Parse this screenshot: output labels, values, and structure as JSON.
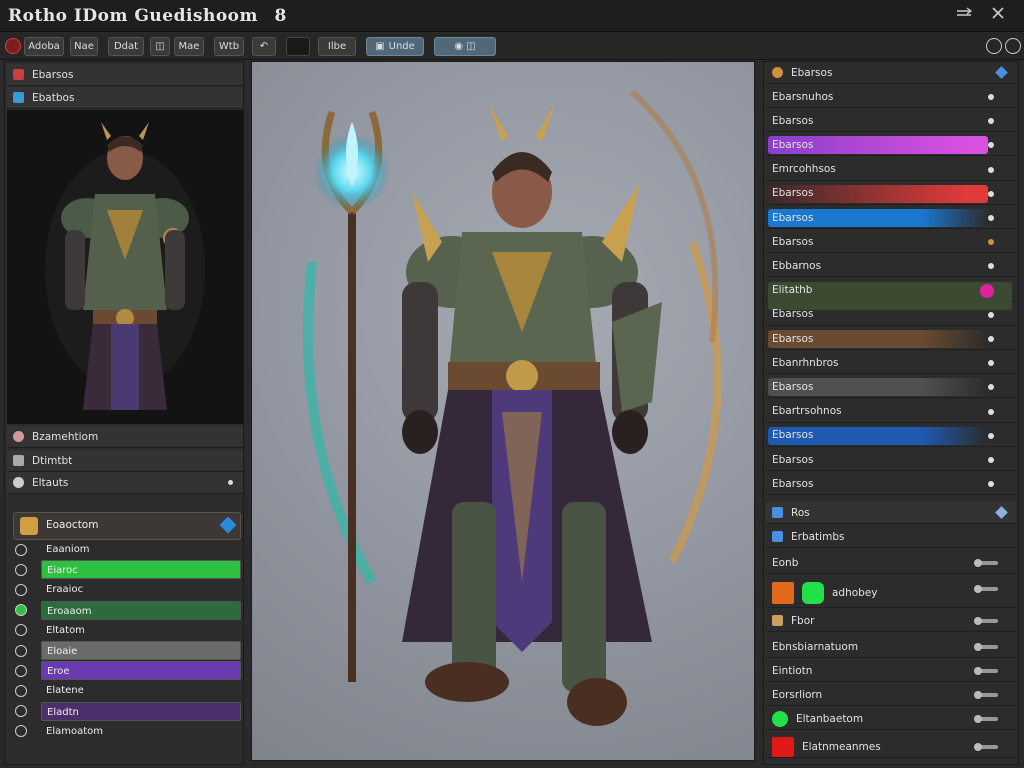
{
  "window": {
    "title": "Rotho IDom Guedishoom",
    "title_suffix": "8"
  },
  "toolbar": {
    "buttons": [
      "Adoba",
      "Nae",
      "Ddat",
      "Mae",
      "Wtb",
      "",
      "Ilbe",
      "Unde",
      "",
      ""
    ]
  },
  "left_panel": {
    "header_1": "Ebarsos",
    "header_2": "Ebatbos",
    "section_rows": [
      "Bzamehtiom",
      "Dtimtbt",
      "Eltauts"
    ],
    "subpanel_label": "Eoaoctom",
    "layers": [
      {
        "label": "Eaaniom",
        "style": "plain",
        "color": ""
      },
      {
        "label": "Eiaroc",
        "style": "bar",
        "color": "#2ec040"
      },
      {
        "label": "Eraaioc",
        "style": "plain",
        "color": ""
      },
      {
        "label": "Eroaaom",
        "style": "bar",
        "color": "#2d6a3c"
      },
      {
        "label": "Eltatom",
        "style": "plain",
        "color": ""
      },
      {
        "label": "Eloaie",
        "style": "bar",
        "color": "#6b6b6b"
      },
      {
        "label": "Eroe",
        "style": "bar",
        "color": "#6a3ab0"
      },
      {
        "label": "Elatene",
        "style": "plain",
        "color": ""
      },
      {
        "label": "Eladtn",
        "style": "bar",
        "color": "#4a2f6a"
      },
      {
        "label": "Elamoatom",
        "style": "plain",
        "color": ""
      }
    ]
  },
  "right_panel": {
    "header": "Ebarsos",
    "rows": [
      {
        "label": "Ebarsnuhos",
        "bar": ""
      },
      {
        "label": "Ebarsos",
        "bar": ""
      },
      {
        "label": "Ebarsos",
        "bar": "#a040c8"
      },
      {
        "label": "Emrcohhsos",
        "bar": ""
      },
      {
        "label": "Ebarsos",
        "bar": "#c03030"
      },
      {
        "label": "Ebarsos",
        "bar": "#1a78d0"
      },
      {
        "label": "Ebarsos",
        "bar": ""
      },
      {
        "label": "Ebbarnos",
        "bar": ""
      },
      {
        "label": "Elitathb",
        "bar": "#3b5a2e"
      },
      {
        "label": "Ebarsos",
        "bar": ""
      },
      {
        "label": "Ebarsos",
        "bar": "#6a4a30"
      },
      {
        "label": "Ebanrhnbros",
        "bar": ""
      },
      {
        "label": "Ebarsos",
        "bar": "#505050"
      },
      {
        "label": "Ebartrsohnos",
        "bar": ""
      },
      {
        "label": "Ebarsos",
        "bar": "#1d5ab0"
      },
      {
        "label": "Ebarsos",
        "bar": ""
      },
      {
        "label": "Ebarsos",
        "bar": ""
      }
    ],
    "section2_header": "Ros",
    "section2_rows": [
      {
        "label": "Erbatimbs"
      },
      {
        "label": "Eonb"
      },
      {
        "label": "adhobey"
      },
      {
        "label": "Fbor"
      },
      {
        "label": "Ebnsbiarnatuom"
      },
      {
        "label": "Eintiotn"
      },
      {
        "label": "Eorsrliorn"
      },
      {
        "label": "Eltanbaetom"
      },
      {
        "label": "Elatnmeanmes"
      }
    ]
  },
  "colors": {
    "accent_green": "#22e04a",
    "accent_magenta": "#e020a0",
    "accent_orange": "#e06a1a",
    "accent_red": "#e01818",
    "accent_blue": "#2a8ae0"
  }
}
